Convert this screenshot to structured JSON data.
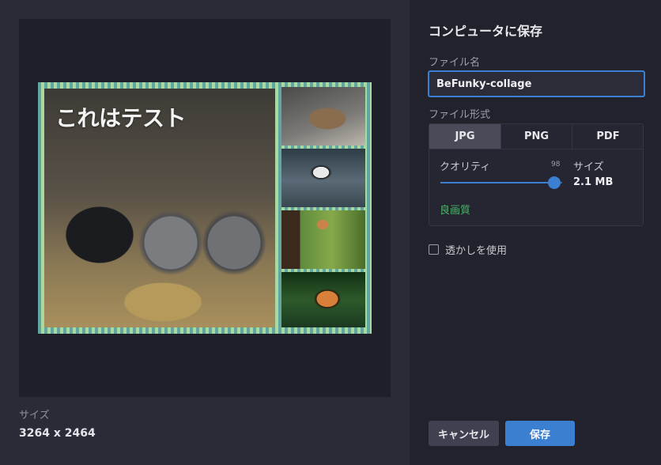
{
  "preview": {
    "overlay_text": "これはテスト",
    "size_label": "サイズ",
    "size_value": "3264 x 2464"
  },
  "panel": {
    "title": "コンピュータに保存",
    "filename_label": "ファイル名",
    "filename_value": "BeFunky-collage",
    "format_label": "ファイル形式",
    "formats": [
      {
        "label": "JPG",
        "selected": true
      },
      {
        "label": "PNG",
        "selected": false
      },
      {
        "label": "PDF",
        "selected": false
      }
    ],
    "quality_label": "クオリティ",
    "quality_value": "98",
    "quality_level": 0.98,
    "size_label": "サイズ",
    "size_value": "2.1 MB",
    "quality_text": "良画質",
    "watermark_label": "透かしを使用",
    "watermark_checked": false,
    "cancel_label": "キャンセル",
    "save_label": "保存"
  },
  "colors": {
    "accent": "#3b7fd1",
    "good_quality": "#4cb468"
  }
}
